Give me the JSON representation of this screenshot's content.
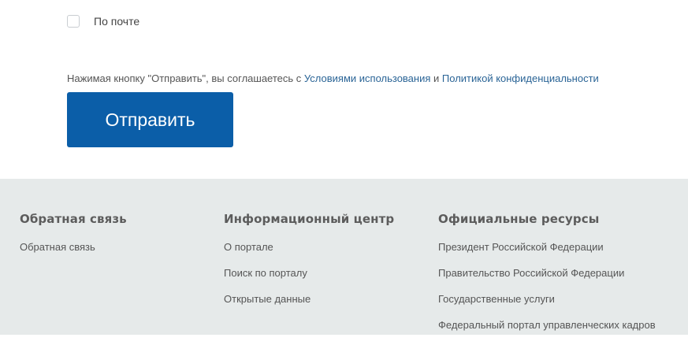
{
  "form": {
    "checkbox_label": "По почте",
    "terms_prefix": "Нажимая кнопку \"Отправить\", вы соглашаетесь с ",
    "terms_link": "Условиями использования",
    "terms_and": " и ",
    "privacy_link": "Политикой конфиденциальности",
    "submit_label": "Отправить"
  },
  "footer": {
    "columns": [
      {
        "title": "Обратная связь",
        "links": [
          "Обратная связь"
        ]
      },
      {
        "title": "Информационный центр",
        "links": [
          "О портале",
          "Поиск по порталу",
          "Открытые данные"
        ]
      },
      {
        "title": "Официальные ресурсы",
        "links": [
          "Президент Российской Федерации",
          "Правительство Российской Федерации",
          "Государственные услуги",
          "Федеральный портал управленческих кадров"
        ]
      }
    ]
  },
  "colors": {
    "button": "#0b5ea8",
    "link": "#2a6496",
    "footer_bg": "#e6eaea"
  }
}
